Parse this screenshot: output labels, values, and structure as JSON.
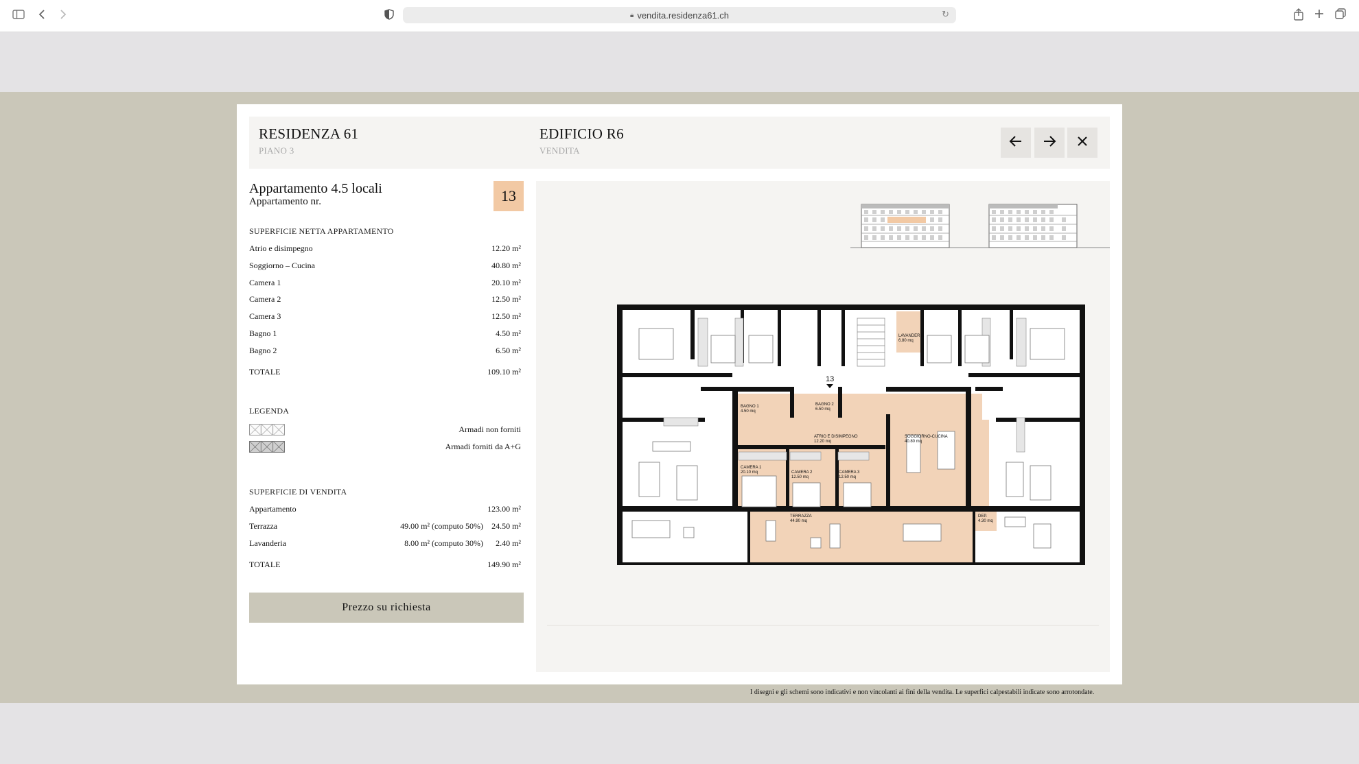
{
  "browser": {
    "url": "vendita.residenza61.ch"
  },
  "header": {
    "project_title": "RESIDENZA 61",
    "project_sub": "PIANO 3",
    "building_title": "EDIFICIO R6",
    "building_sub": "VENDITA"
  },
  "apartment": {
    "title": "Appartamento 4.5 locali",
    "subtitle": "Appartamento nr.",
    "number": "13"
  },
  "net_surface": {
    "label": "SUPERFICIE NETTA APPARTAMENTO",
    "rows": [
      {
        "name": "Atrio e disimpegno",
        "value": "12.20 m²"
      },
      {
        "name": "Soggiorno – Cucina",
        "value": "40.80 m²"
      },
      {
        "name": "Camera 1",
        "value": "20.10 m²"
      },
      {
        "name": "Camera 2",
        "value": "12.50 m²"
      },
      {
        "name": "Camera 3",
        "value": "12.50 m²"
      },
      {
        "name": "Bagno 1",
        "value": "4.50 m²"
      },
      {
        "name": "Bagno 2",
        "value": "6.50 m²"
      }
    ],
    "total_label": "TOTALE",
    "total_value": "109.10 m²"
  },
  "legend": {
    "label": "LEGENDA",
    "items": [
      {
        "text": "Armadi non forniti"
      },
      {
        "text": "Armadi forniti da A+G"
      }
    ]
  },
  "sales_surface": {
    "label": "SUPERFICIE DI VENDITA",
    "rows": [
      {
        "name": "Appartamento",
        "middle": "",
        "value": "123.00 m²"
      },
      {
        "name": "Terrazza",
        "middle": "49.00 m² (computo 50%)",
        "value": "24.50 m²"
      },
      {
        "name": "Lavanderia",
        "middle": "8.00 m² (computo 30%)",
        "value": "2.40 m²"
      }
    ],
    "total_label": "TOTALE",
    "total_value": "149.90 m²"
  },
  "price_button": "Prezzo su richiesta",
  "plan": {
    "marker": "13",
    "labels": {
      "lavanderia": "LAVANDERIA",
      "lavanderia_area": "6.80 mq",
      "bagno1": "BAGNO 1",
      "bagno1_area": "4.50 mq",
      "bagno2": "BAGNO 2",
      "bagno2_area": "6.50 mq",
      "atrio": "ATRIO E DISIMPEGNO",
      "atrio_area": "12.20 mq",
      "soggiorno": "SOGGIORNO-CUCINA",
      "soggiorno_area": "40.80 mq",
      "camera1": "CAMERA 1",
      "camera1_area": "20.10 mq",
      "camera2": "CAMERA 2",
      "camera2_area": "12.50 mq",
      "camera3": "CAMERA 3",
      "camera3_area": "12.50 mq",
      "terrazza": "TERRAZZA",
      "terrazza_area": "44.90 mq",
      "dep": "DEP.",
      "dep_area": "4.30 mq"
    }
  },
  "footnote": "I disegni e gli schemi sono indicativi e non vincolanti ai fini della vendita. Le superfici calpestabili indicate sono arrotondate.",
  "colors": {
    "accent": "#f2c9a4",
    "beige": "#cac7b9",
    "panel": "#f5f4f2"
  },
  "icons": [
    "sidebar-icon",
    "back-icon",
    "forward-icon",
    "shield-icon",
    "lock-icon",
    "reload-icon",
    "share-icon",
    "plus-icon",
    "tabs-icon",
    "arrow-left-icon",
    "arrow-right-icon",
    "close-icon"
  ]
}
